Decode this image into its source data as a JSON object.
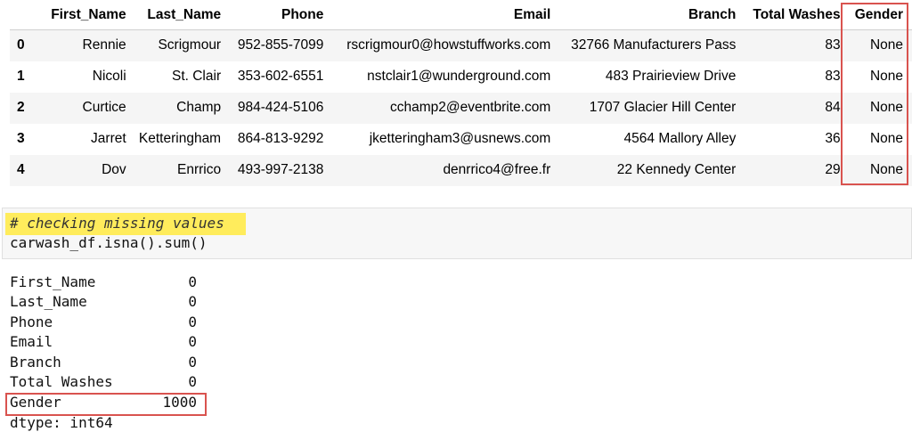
{
  "table": {
    "columns": [
      "",
      "First_Name",
      "Last_Name",
      "Phone",
      "Email",
      "Branch",
      "Total Washes",
      "Gender"
    ],
    "rows": [
      {
        "index": "0",
        "first": "Rennie",
        "last": "Scrigmour",
        "phone": "952-855-7099",
        "email": "rscrigmour0@howstuffworks.com",
        "branch": "32766 Manufacturers Pass",
        "washes": "83",
        "gender": "None"
      },
      {
        "index": "1",
        "first": "Nicoli",
        "last": "St. Clair",
        "phone": "353-602-6551",
        "email": "nstclair1@wunderground.com",
        "branch": "483 Prairieview Drive",
        "washes": "83",
        "gender": "None"
      },
      {
        "index": "2",
        "first": "Curtice",
        "last": "Champ",
        "phone": "984-424-5106",
        "email": "cchamp2@eventbrite.com",
        "branch": "1707 Glacier Hill Center",
        "washes": "84",
        "gender": "None"
      },
      {
        "index": "3",
        "first": "Jarret",
        "last": "Ketteringham",
        "phone": "864-813-9292",
        "email": "jketteringham3@usnews.com",
        "branch": "4564 Mallory Alley",
        "washes": "36",
        "gender": "None"
      },
      {
        "index": "4",
        "first": "Dov",
        "last": "Enrrico",
        "phone": "493-997-2138",
        "email": "denrrico4@free.fr",
        "branch": "22 Kennedy Center",
        "washes": "29",
        "gender": "None"
      }
    ]
  },
  "code_cell": {
    "comment": "# checking missing values",
    "code": "carwash_df.isna().sum()"
  },
  "output": {
    "rows": [
      {
        "key": "First_Name",
        "value": "0"
      },
      {
        "key": "Last_Name",
        "value": "0"
      },
      {
        "key": "Phone",
        "value": "0"
      },
      {
        "key": "Email",
        "value": "0"
      },
      {
        "key": "Branch",
        "value": "0"
      },
      {
        "key": "Total Washes",
        "value": "0"
      },
      {
        "key": "Gender",
        "value": "1000"
      }
    ],
    "dtype": "dtype: int64"
  },
  "colors": {
    "highlight_box": "#d9534f",
    "comment_highlight": "#ffec5c",
    "row_stripe": "#f5f5f5"
  }
}
